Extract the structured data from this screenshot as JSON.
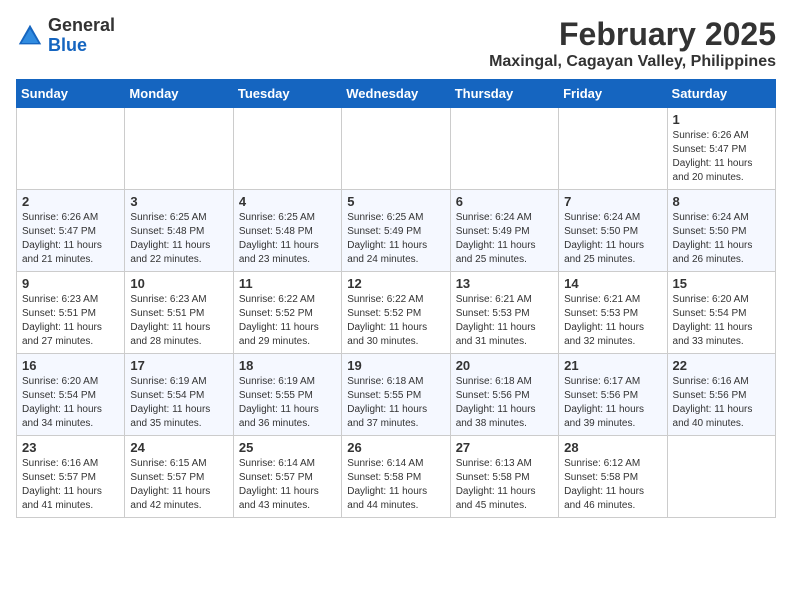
{
  "header": {
    "logo_general": "General",
    "logo_blue": "Blue",
    "month_title": "February 2025",
    "location": "Maxingal, Cagayan Valley, Philippines"
  },
  "days_of_week": [
    "Sunday",
    "Monday",
    "Tuesday",
    "Wednesday",
    "Thursday",
    "Friday",
    "Saturday"
  ],
  "weeks": [
    [
      {
        "day": "",
        "info": ""
      },
      {
        "day": "",
        "info": ""
      },
      {
        "day": "",
        "info": ""
      },
      {
        "day": "",
        "info": ""
      },
      {
        "day": "",
        "info": ""
      },
      {
        "day": "",
        "info": ""
      },
      {
        "day": "1",
        "info": "Sunrise: 6:26 AM\nSunset: 5:47 PM\nDaylight: 11 hours\nand 20 minutes."
      }
    ],
    [
      {
        "day": "2",
        "info": "Sunrise: 6:26 AM\nSunset: 5:47 PM\nDaylight: 11 hours\nand 21 minutes."
      },
      {
        "day": "3",
        "info": "Sunrise: 6:25 AM\nSunset: 5:48 PM\nDaylight: 11 hours\nand 22 minutes."
      },
      {
        "day": "4",
        "info": "Sunrise: 6:25 AM\nSunset: 5:48 PM\nDaylight: 11 hours\nand 23 minutes."
      },
      {
        "day": "5",
        "info": "Sunrise: 6:25 AM\nSunset: 5:49 PM\nDaylight: 11 hours\nand 24 minutes."
      },
      {
        "day": "6",
        "info": "Sunrise: 6:24 AM\nSunset: 5:49 PM\nDaylight: 11 hours\nand 25 minutes."
      },
      {
        "day": "7",
        "info": "Sunrise: 6:24 AM\nSunset: 5:50 PM\nDaylight: 11 hours\nand 25 minutes."
      },
      {
        "day": "8",
        "info": "Sunrise: 6:24 AM\nSunset: 5:50 PM\nDaylight: 11 hours\nand 26 minutes."
      }
    ],
    [
      {
        "day": "9",
        "info": "Sunrise: 6:23 AM\nSunset: 5:51 PM\nDaylight: 11 hours\nand 27 minutes."
      },
      {
        "day": "10",
        "info": "Sunrise: 6:23 AM\nSunset: 5:51 PM\nDaylight: 11 hours\nand 28 minutes."
      },
      {
        "day": "11",
        "info": "Sunrise: 6:22 AM\nSunset: 5:52 PM\nDaylight: 11 hours\nand 29 minutes."
      },
      {
        "day": "12",
        "info": "Sunrise: 6:22 AM\nSunset: 5:52 PM\nDaylight: 11 hours\nand 30 minutes."
      },
      {
        "day": "13",
        "info": "Sunrise: 6:21 AM\nSunset: 5:53 PM\nDaylight: 11 hours\nand 31 minutes."
      },
      {
        "day": "14",
        "info": "Sunrise: 6:21 AM\nSunset: 5:53 PM\nDaylight: 11 hours\nand 32 minutes."
      },
      {
        "day": "15",
        "info": "Sunrise: 6:20 AM\nSunset: 5:54 PM\nDaylight: 11 hours\nand 33 minutes."
      }
    ],
    [
      {
        "day": "16",
        "info": "Sunrise: 6:20 AM\nSunset: 5:54 PM\nDaylight: 11 hours\nand 34 minutes."
      },
      {
        "day": "17",
        "info": "Sunrise: 6:19 AM\nSunset: 5:54 PM\nDaylight: 11 hours\nand 35 minutes."
      },
      {
        "day": "18",
        "info": "Sunrise: 6:19 AM\nSunset: 5:55 PM\nDaylight: 11 hours\nand 36 minutes."
      },
      {
        "day": "19",
        "info": "Sunrise: 6:18 AM\nSunset: 5:55 PM\nDaylight: 11 hours\nand 37 minutes."
      },
      {
        "day": "20",
        "info": "Sunrise: 6:18 AM\nSunset: 5:56 PM\nDaylight: 11 hours\nand 38 minutes."
      },
      {
        "day": "21",
        "info": "Sunrise: 6:17 AM\nSunset: 5:56 PM\nDaylight: 11 hours\nand 39 minutes."
      },
      {
        "day": "22",
        "info": "Sunrise: 6:16 AM\nSunset: 5:56 PM\nDaylight: 11 hours\nand 40 minutes."
      }
    ],
    [
      {
        "day": "23",
        "info": "Sunrise: 6:16 AM\nSunset: 5:57 PM\nDaylight: 11 hours\nand 41 minutes."
      },
      {
        "day": "24",
        "info": "Sunrise: 6:15 AM\nSunset: 5:57 PM\nDaylight: 11 hours\nand 42 minutes."
      },
      {
        "day": "25",
        "info": "Sunrise: 6:14 AM\nSunset: 5:57 PM\nDaylight: 11 hours\nand 43 minutes."
      },
      {
        "day": "26",
        "info": "Sunrise: 6:14 AM\nSunset: 5:58 PM\nDaylight: 11 hours\nand 44 minutes."
      },
      {
        "day": "27",
        "info": "Sunrise: 6:13 AM\nSunset: 5:58 PM\nDaylight: 11 hours\nand 45 minutes."
      },
      {
        "day": "28",
        "info": "Sunrise: 6:12 AM\nSunset: 5:58 PM\nDaylight: 11 hours\nand 46 minutes."
      },
      {
        "day": "",
        "info": ""
      }
    ]
  ]
}
